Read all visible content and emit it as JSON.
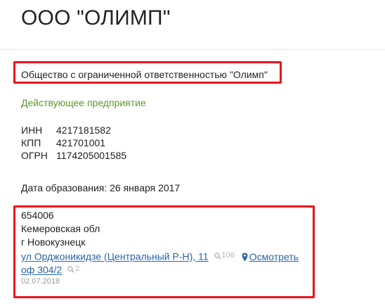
{
  "header": {
    "title": "ООО \"ОЛИМП\""
  },
  "company": {
    "full_name": "Общество с ограниченной ответственностью \"Олимп\"",
    "status": "Действующее предприятие",
    "codes": [
      {
        "label": "ИНН",
        "value": "4217181582"
      },
      {
        "label": "КПП",
        "value": "421701001"
      },
      {
        "label": "ОГРН",
        "value": "1174205001585"
      }
    ],
    "registration_date": "Дата образования: 26 января 2017",
    "colors": {
      "status": "#5a9b2a",
      "link": "#2a64a8",
      "highlight_border": "#e8141c"
    }
  },
  "address": {
    "postcode": "654006",
    "region": "Кемеровская обл",
    "city": "г Новокузнецк",
    "street_link": "ул Орджоникидзе (Центральный Р-Н), 11",
    "street_search_count": "106",
    "view_link_part1": "Осмотреть",
    "view_link_part2": "оф 304/2",
    "office_search_count": "2",
    "update_date": "02.07.2018",
    "icons": {
      "search": "magnifier-icon",
      "location": "map-pin-icon"
    }
  }
}
